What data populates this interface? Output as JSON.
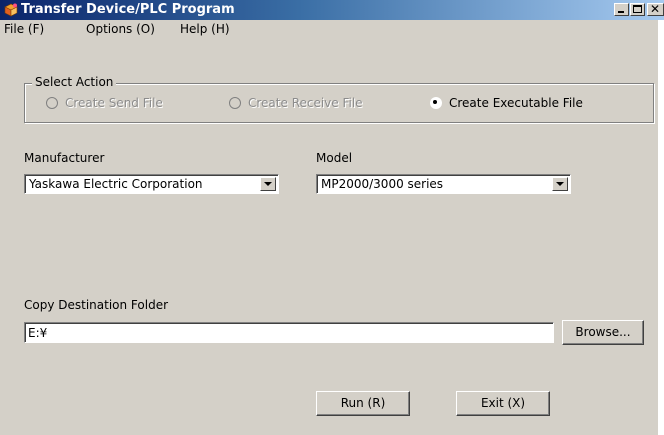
{
  "window": {
    "title": "Transfer Device/PLC Program",
    "icon": "transfer-program-icon",
    "controls": [
      "minimize-icon",
      "maximize-icon",
      "close-icon"
    ]
  },
  "menu": {
    "file": "File (F)",
    "options": "Options (O)",
    "help": "Help (H)"
  },
  "select_action": {
    "legend": "Select Action",
    "options": [
      {
        "label": "Create Send File",
        "enabled": false,
        "selected": false
      },
      {
        "label": "Create Receive File",
        "enabled": false,
        "selected": false
      },
      {
        "label": "Create Executable File",
        "enabled": true,
        "selected": true
      }
    ]
  },
  "manufacturer": {
    "label": "Manufacturer",
    "value": "Yaskawa Electric Corporation"
  },
  "model": {
    "label": "Model",
    "value": "MP2000/3000 series"
  },
  "destination": {
    "label": "Copy Destination Folder",
    "value": "E:¥",
    "browse_label": "Browse..."
  },
  "actions": {
    "run_label": "Run (R)",
    "exit_label": "Exit (X)"
  }
}
